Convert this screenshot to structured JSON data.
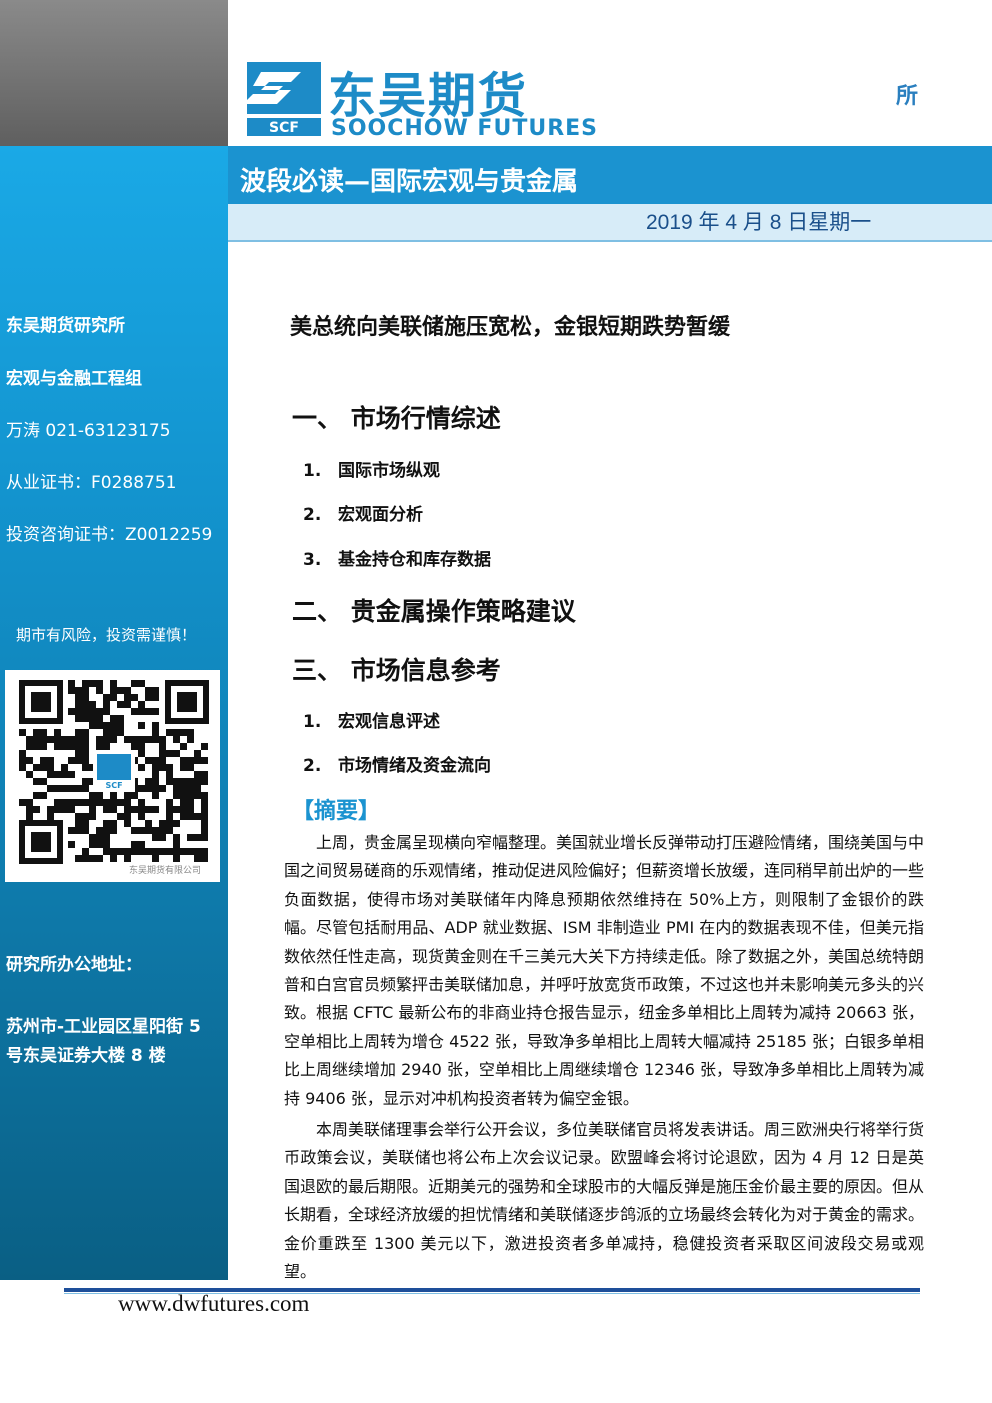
{
  "header": {
    "brand_cn": "东吴期货",
    "brand_en": "SOOCHOW FUTURES",
    "logo_text": "SCF",
    "corner_text": "所",
    "report_title": "波段必读—国际宏观与贵金属",
    "date": "2019 年 4 月 8 日星期一"
  },
  "sidebar": {
    "institute": "东吴期货研究所",
    "group": "宏观与金融工程组",
    "analyst": "万涛 021-63123175",
    "license": "从业证书：F0288751",
    "consult_license": "投资咨询证书：Z0012259",
    "risk_notice": "期市有风险，投资需谨慎！",
    "qr_caption": "东吴期货有限公司",
    "address_label": "研究所办公地址：",
    "address_line1": "苏州市-工业园区星阳街 5",
    "address_line2": "号东吴证券大楼 8 楼"
  },
  "main": {
    "headline": "美总统向美联储施压宽松，金银短期跌势暂缓",
    "sections": [
      {
        "label": "一、 市场行情综述",
        "items": [
          {
            "num": "1.",
            "label": "国际市场纵观"
          },
          {
            "num": "2.",
            "label": "宏观面分析"
          },
          {
            "num": "3.",
            "label": "基金持仓和库存数据"
          }
        ]
      },
      {
        "label": "二、 贵金属操作策略建议",
        "items": []
      },
      {
        "label": "三、 市场信息参考",
        "items": [
          {
            "num": "1.",
            "label": "宏观信息评述"
          },
          {
            "num": "2.",
            "label": "市场情绪及资金流向"
          }
        ]
      }
    ],
    "summary_title": "【摘要】",
    "paragraphs": [
      "上周，贵金属呈现横向窄幅整理。美国就业增长反弹带动打压避险情绪，围绕美国与中国之间贸易磋商的乐观情绪，推动促进风险偏好；但薪资增长放缓，连同稍早前出炉的一些负面数据，使得市场对美联储年内降息预期依然维持在 50%上方，则限制了金银价的跌幅。尽管包括耐用品、ADP 就业数据、ISM 非制造业 PMI 在内的数据表现不佳，但美元指数依然任性走高，现货黄金则在千三美元大关下方持续走低。除了数据之外，美国总统特朗普和白宫官员频繁抨击美联储加息，并呼吁放宽货币政策，不过这也并未影响美元多头的兴致。根据 CFTC 最新公布的非商业持仓报告显示，纽金多单相比上周转为减持 20663 张，空单相比上周转为增仓 4522 张，导致净多单相比上周转大幅减持 25185 张；白银多单相比上周继续增加 2940 张，空单相比上周继续增仓 12346 张，导致净多单相比上周转为减持 9406 张，显示对冲机构投资者转为偏空金银。",
      "本周美联储理事会举行公开会议，多位美联储官员将发表讲话。周三欧洲央行将举行货币政策会议，美联储也将公布上次会议记录。欧盟峰会将讨论退欧，因为 4 月 12 日是英国退欧的最后期限。近期美元的强势和全球股市的大幅反弹是施压金价最主要的原因。但从长期看，全球经济放缓的担忧情绪和美联储逐步鸽派的立场最终会转化为对于黄金的需求。金价重跌至 1300 美元以下，激进投资者多单减持，稳健投资者采取区间波段交易或观望。"
    ]
  },
  "footer": {
    "website": "www.dwfutures.com"
  },
  "colors": {
    "brand_blue": "#1d8bc7",
    "sidebar_blue": "#1394cf",
    "title_bar": "#1b93d0",
    "date_bar": "#d7ecf8"
  }
}
